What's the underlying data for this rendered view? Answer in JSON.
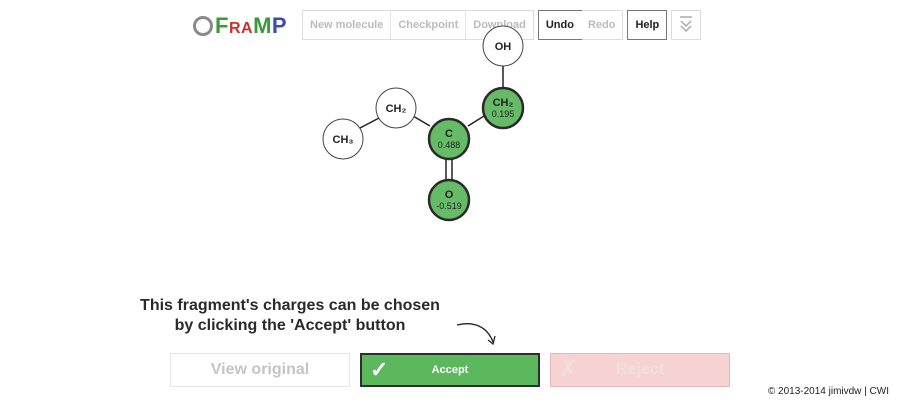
{
  "logo": {
    "text_f": "F",
    "text_r": "R",
    "text_a": "A",
    "text_m": "M",
    "text_p": "P"
  },
  "toolbar": {
    "new_molecule": "New molecule",
    "checkpoint": "Checkpoint",
    "download": "Download",
    "undo": "Undo",
    "redo": "Redo",
    "help": "Help",
    "collapse_icon": "double-chevron-down-icon"
  },
  "molecule": {
    "atoms": {
      "oh": {
        "label": "OH"
      },
      "ch2_left": {
        "label": "CH₂"
      },
      "ch3": {
        "label": "CH₃"
      },
      "c": {
        "label": "C",
        "charge": "0.488"
      },
      "ch2_right": {
        "label": "CH₂",
        "charge": "0.195"
      },
      "o": {
        "label": "O",
        "charge": "-0.519"
      }
    }
  },
  "message": {
    "line1": "This fragment's charges can be chosen",
    "line2": "by clicking the 'Accept' button"
  },
  "buttons": {
    "view_original": "View original",
    "accept": "Accept",
    "reject": "Reject",
    "accept_icon": "checkmark-icon",
    "reject_icon": "x-icon"
  },
  "footer": {
    "text": "© 2013-2014 jimivdw | CWI"
  },
  "colors": {
    "selected_atom": "#66bb66",
    "accept": "#5cb85c",
    "reject": "#f6d2d2"
  }
}
